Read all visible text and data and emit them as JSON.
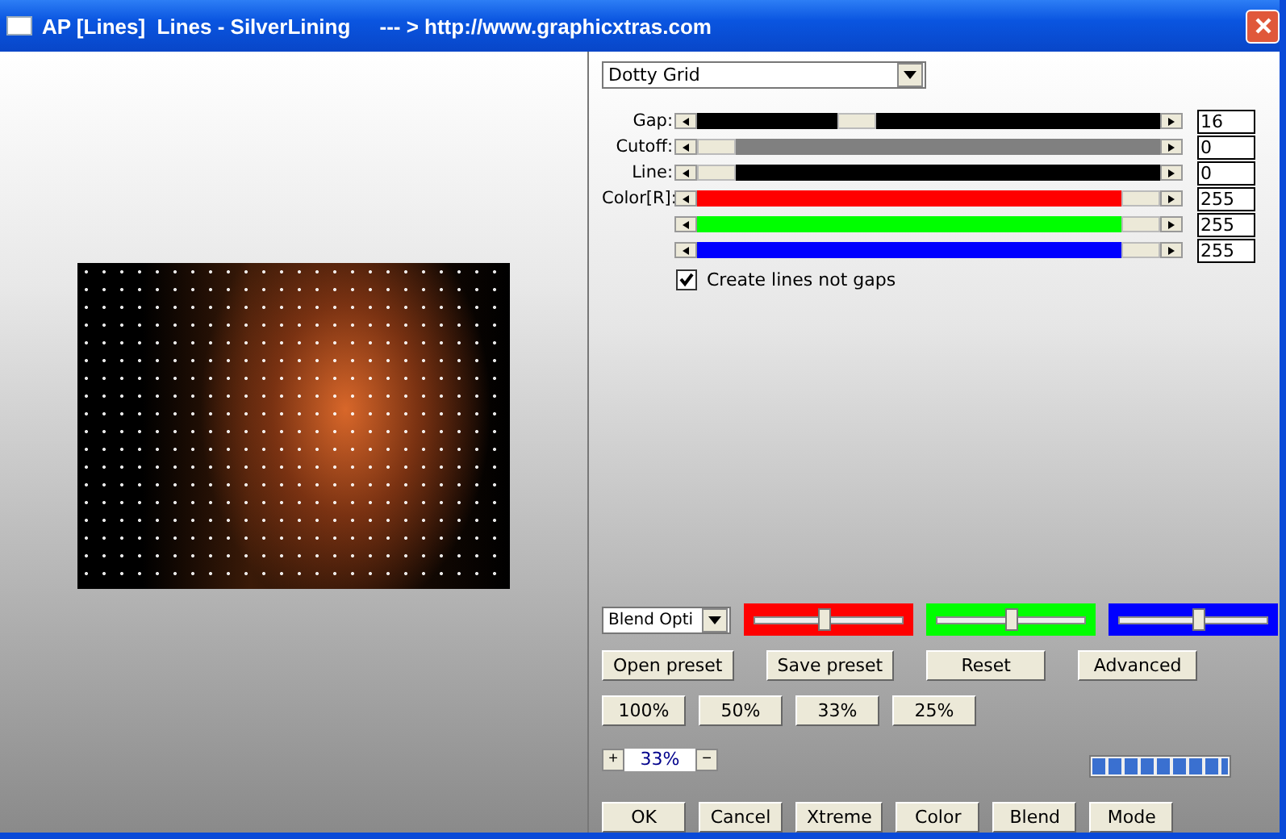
{
  "window": {
    "title": "AP [Lines]  Lines - SilverLining     --- > http://www.graphicxtras.com"
  },
  "effect_dropdown": {
    "value": "Dotty Grid"
  },
  "sliders": [
    {
      "label": "Gap:",
      "kind": "plain",
      "level": 0.33,
      "value": "16"
    },
    {
      "label": "Cutoff:",
      "kind": "muted",
      "level": 0,
      "value": "0"
    },
    {
      "label": "Line:",
      "kind": "plain",
      "level": 0,
      "value": "0"
    },
    {
      "label": "Color[R]:",
      "kind": "color",
      "color": "#ff0000",
      "level": 1,
      "value": "255"
    },
    {
      "kind": "color",
      "color": "#00ff00",
      "level": 1,
      "value": "255"
    },
    {
      "kind": "color",
      "color": "#0000ff",
      "level": 1,
      "value": "255"
    }
  ],
  "checkbox": {
    "label": "Create lines not gaps",
    "checked": true
  },
  "blend_dropdown": {
    "value": "Blend Opti"
  },
  "blend_sliders": [
    {
      "color": "#ff0000",
      "level": 0.47
    },
    {
      "color": "#00ff00",
      "level": 0.5
    },
    {
      "color": "#0000ff",
      "level": 0.54
    }
  ],
  "preset_buttons": [
    "Open preset",
    "Save preset",
    "Reset",
    "Advanced"
  ],
  "zoom_buttons": [
    "100%",
    "50%",
    "33%",
    "25%"
  ],
  "zoom_stepper": {
    "plus": "+",
    "value": "33%",
    "minus": "−"
  },
  "progress": {
    "level": 1
  },
  "bottom_buttons": [
    "OK",
    "Cancel",
    "Xtreme",
    "Color",
    "Blend",
    "Mode"
  ]
}
